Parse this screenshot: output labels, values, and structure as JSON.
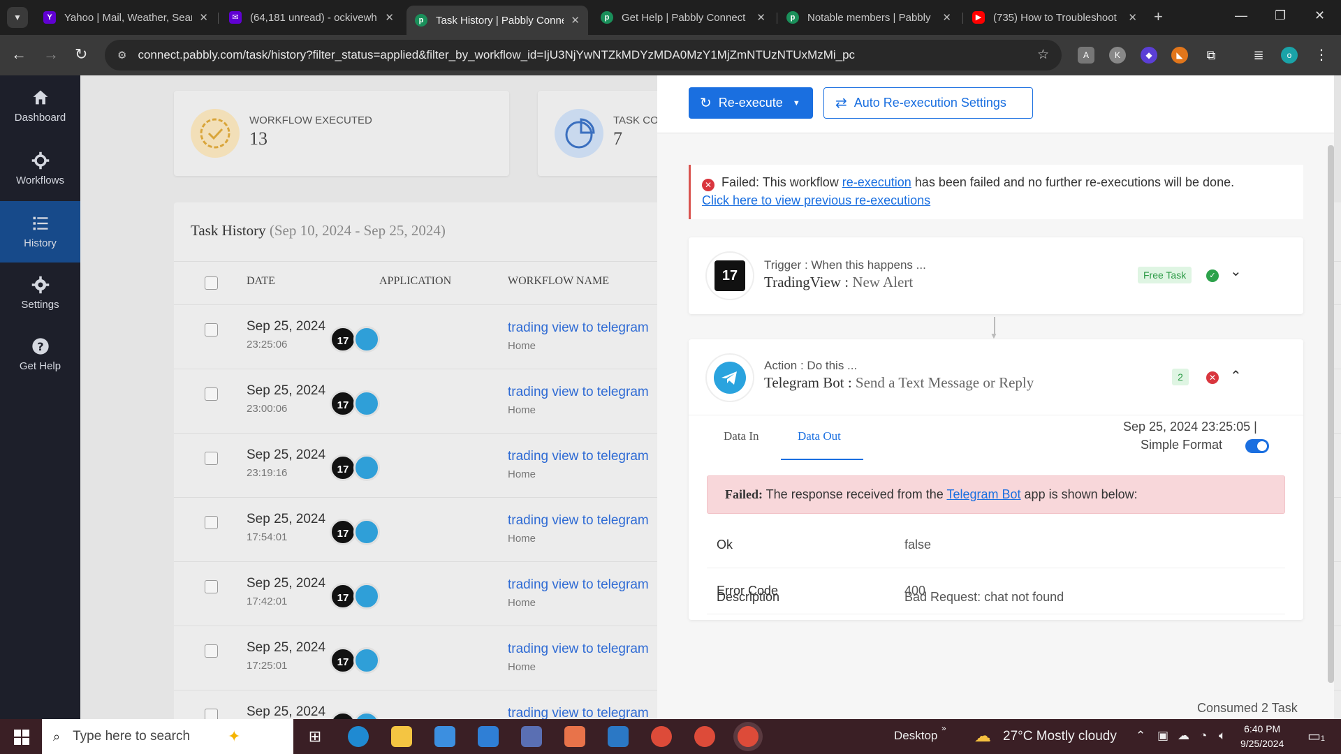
{
  "browser": {
    "tabs": [
      {
        "title": "Yahoo | Mail, Weather, Search",
        "favicon": "yahoo-icon",
        "active": false
      },
      {
        "title": "(64,181 unread) - ockivewh",
        "favicon": "yahoo-mail-icon",
        "active": false
      },
      {
        "title": "Task History | Pabbly Connect",
        "favicon": "pabbly-icon",
        "active": true
      },
      {
        "title": "Get Help | Pabbly Connect",
        "favicon": "pabbly-icon",
        "active": false
      },
      {
        "title": "Notable members | Pabbly",
        "favicon": "pabbly-icon",
        "active": false
      },
      {
        "title": "(735) How to Troubleshoot",
        "favicon": "youtube-icon",
        "active": false
      }
    ],
    "url": "connect.pabbly.com/task/history?filter_status=applied&filter_by_workflow_id=IjU3NjYwNTZkMDYzMDA0MzY1MjZmNTUzNTUxMzMi_pc",
    "profile_initial": "o"
  },
  "sidebar": {
    "items": [
      {
        "label": "Dashboard",
        "icon": "home-icon",
        "active": false
      },
      {
        "label": "Workflows",
        "icon": "workflow-icon",
        "active": false
      },
      {
        "label": "History",
        "icon": "list-icon",
        "active": true
      },
      {
        "label": "Settings",
        "icon": "gear-icon",
        "active": false
      },
      {
        "label": "Get Help",
        "icon": "help-icon",
        "active": false
      }
    ]
  },
  "stats": {
    "workflow_executed_label": "WORKFLOW EXECUTED",
    "workflow_executed_value": "13",
    "task_consumed_label": "TASK CO",
    "task_consumed_value": "7"
  },
  "history": {
    "title": "Task History",
    "range": "(Sep 10, 2024 - Sep 25, 2024)",
    "columns": [
      "DATE",
      "APPLICATION",
      "WORKFLOW NAME"
    ],
    "rows": [
      {
        "date": "Sep 25, 2024",
        "time": "23:25:06",
        "workflow": "trading view to telegram",
        "folder": "Home"
      },
      {
        "date": "Sep 25, 2024",
        "time": "23:00:06",
        "workflow": "trading view to telegram",
        "folder": "Home"
      },
      {
        "date": "Sep 25, 2024",
        "time": "23:19:16",
        "workflow": "trading view to telegram",
        "folder": "Home"
      },
      {
        "date": "Sep 25, 2024",
        "time": "17:54:01",
        "workflow": "trading view to telegram",
        "folder": "Home"
      },
      {
        "date": "Sep 25, 2024",
        "time": "17:42:01",
        "workflow": "trading view to telegram",
        "folder": "Home"
      },
      {
        "date": "Sep 25, 2024",
        "time": "17:25:01",
        "workflow": "trading view to telegram",
        "folder": "Home"
      },
      {
        "date": "Sep 25, 2024",
        "time": "",
        "workflow": "trading view to telegram",
        "folder": ""
      }
    ]
  },
  "panel": {
    "reexecute_label": "Re-execute",
    "auto_reexecute_label": "Auto Re-execution Settings",
    "fail_banner": {
      "prefix": "Failed: This workflow ",
      "link": "re-execution",
      "suffix": " has been failed and no further re-executions will be done.",
      "view_link": "Click here to view previous re-executions"
    },
    "trigger": {
      "kind": "Trigger : When this happens ...",
      "app": "TradingView",
      "separator": " : ",
      "event": "New Alert",
      "badge": "Free Task"
    },
    "action": {
      "kind": "Action : Do this ...",
      "app": "Telegram Bot",
      "separator": " : ",
      "event": "Send a Text Message or Reply",
      "badge": "2",
      "tabs": [
        "Data In",
        "Data Out"
      ],
      "timestamp": "Sep 25, 2024 23:25:05  |",
      "simple_format": "Simple Format",
      "response": {
        "failed_label": "Failed:",
        "text_before": " The response received from the ",
        "app_link": "Telegram Bot",
        "text_after": " app is shown below:"
      },
      "fields": [
        {
          "key": "Ok",
          "value": "false"
        },
        {
          "key": "Error Code",
          "value": "400"
        },
        {
          "key": "Description",
          "value": "Bad Request: chat not found"
        }
      ]
    },
    "consumed": "Consumed 2 Task"
  },
  "taskbar": {
    "search_placeholder": "Type here to search",
    "desktop_label": "Desktop",
    "weather": "27°C  Mostly cloudy",
    "time": "6:40 PM",
    "date": "9/25/2024",
    "notification_count": "1"
  },
  "colors": {
    "primary": "#1a6fe0",
    "sidebar_bg": "#1d1f2a",
    "sidebar_active": "#174a8a",
    "error": "#d9363e",
    "success": "#2ca24b"
  }
}
